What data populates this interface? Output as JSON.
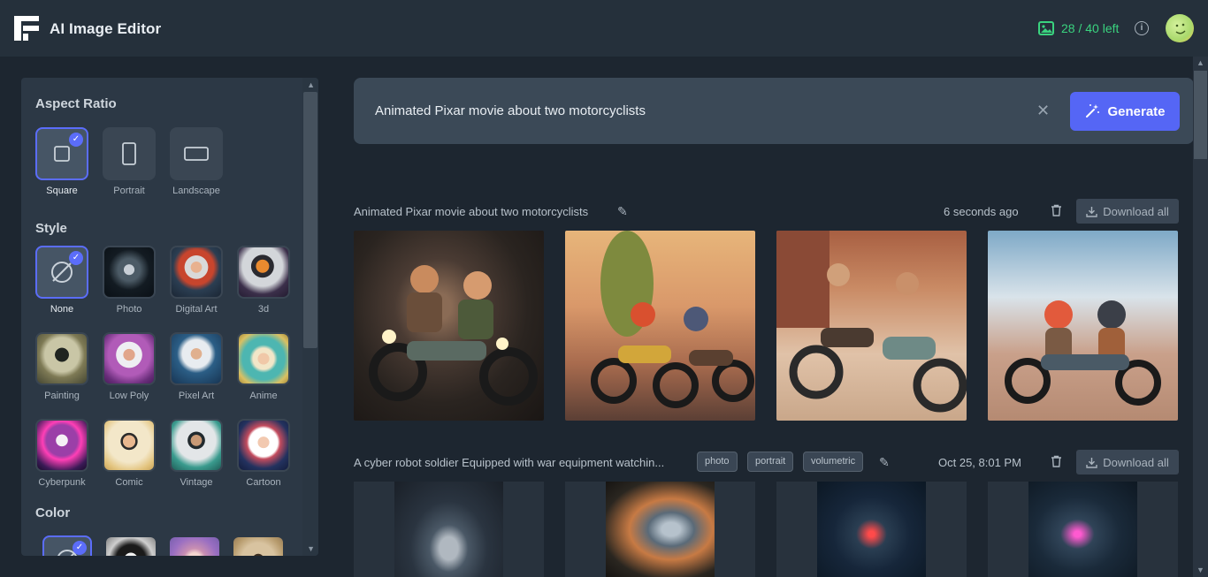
{
  "header": {
    "app_title": "AI Image Editor",
    "credits": "28 / 40 left",
    "logo_icon": "logo-icon",
    "credits_icon": "image-icon",
    "info_icon": "info-icon"
  },
  "sidebar": {
    "aspect_ratio": {
      "title": "Aspect Ratio",
      "options": [
        "Square",
        "Portrait",
        "Landscape"
      ],
      "selected": "Square"
    },
    "style": {
      "title": "Style",
      "options": [
        "None",
        "Photo",
        "Digital Art",
        "3d",
        "Painting",
        "Low Poly",
        "Pixel Art",
        "Anime",
        "Cyberpunk",
        "Comic",
        "Vintage",
        "Cartoon"
      ],
      "selected": "None"
    },
    "color": {
      "title": "Color"
    }
  },
  "prompt": {
    "text": "Animated Pixar movie about two motorcyclists",
    "generate_label": "Generate"
  },
  "groups": [
    {
      "prompt": "Animated Pixar movie about two motorcyclists",
      "tags": [],
      "time": "6 seconds ago",
      "download_label": "Download all"
    },
    {
      "prompt": "A cyber robot soldier Equipped with war equipment watchin...",
      "tags": [
        "photo",
        "portrait",
        "volumetric"
      ],
      "time": "Oct 25, 8:01 PM",
      "download_label": "Download all"
    }
  ],
  "colors": {
    "accent": "#5566f5",
    "credits": "#3ad37f",
    "background": "#1d2630",
    "panel": "#2c3845"
  }
}
